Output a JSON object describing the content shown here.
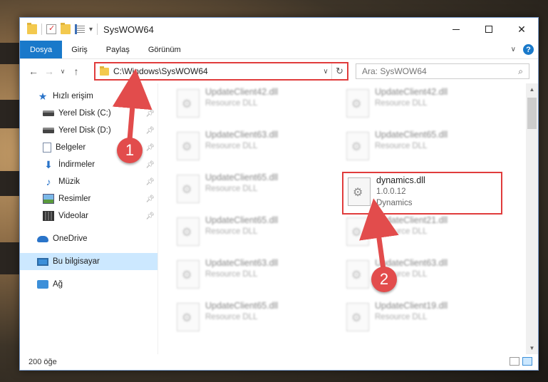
{
  "window": {
    "title": "SysWOW64"
  },
  "ribbon": {
    "tabs": [
      "Dosya",
      "Giriş",
      "Paylaş",
      "Görünüm"
    ]
  },
  "address": {
    "path": "C:\\Windows\\SysWOW64"
  },
  "search": {
    "placeholder": "Ara: SysWOW64"
  },
  "sidebar": {
    "quick_access": "Hızlı erişim",
    "items": [
      {
        "label": "Yerel Disk (C:)",
        "icon": "drive-icon"
      },
      {
        "label": "Yerel Disk (D:)",
        "icon": "drive-icon"
      },
      {
        "label": "Belgeler",
        "icon": "documents-icon"
      },
      {
        "label": "İndirmeler",
        "icon": "downloads-icon"
      },
      {
        "label": "Müzik",
        "icon": "music-icon"
      },
      {
        "label": "Resimler",
        "icon": "pictures-icon"
      },
      {
        "label": "Videolar",
        "icon": "videos-icon"
      }
    ],
    "onedrive": "OneDrive",
    "this_pc": "Bu bilgisayar",
    "network": "Ağ"
  },
  "files": [
    {
      "name": "UpdateClient42.dll",
      "type": "Resource DLL"
    },
    {
      "name": "UpdateClient42.dll",
      "type": "Resource DLL"
    },
    {
      "name": "UpdateClient63.dll",
      "type": "Resource DLL"
    },
    {
      "name": "UpdateClient65.dll",
      "type": "Resource DLL"
    },
    {
      "name": "UpdateClient65.dll",
      "type": "Resource DLL"
    },
    {
      "name": "UpdateClient65.dll",
      "type": "Resource DLL"
    },
    {
      "name": "UpdateClient21.dll",
      "type": "Resource DLL"
    },
    {
      "name": "UpdateClient63.dll",
      "type": "Resource DLL"
    },
    {
      "name": "UpdateClient63.dll",
      "type": "Resource DLL"
    },
    {
      "name": "UpdateClient65.dll",
      "type": "Resource DLL"
    },
    {
      "name": "UpdateClient19.dll",
      "type": "Resource DLL"
    }
  ],
  "highlighted_file": {
    "name": "dynamics.dll",
    "version": "1.0.0.12",
    "description": "Dynamics"
  },
  "status": {
    "count": "200 öğe"
  },
  "callouts": [
    "1",
    "2"
  ],
  "colors": {
    "accent": "#1979ca",
    "highlight": "#e03c3c",
    "callout": "#e24c4c"
  }
}
